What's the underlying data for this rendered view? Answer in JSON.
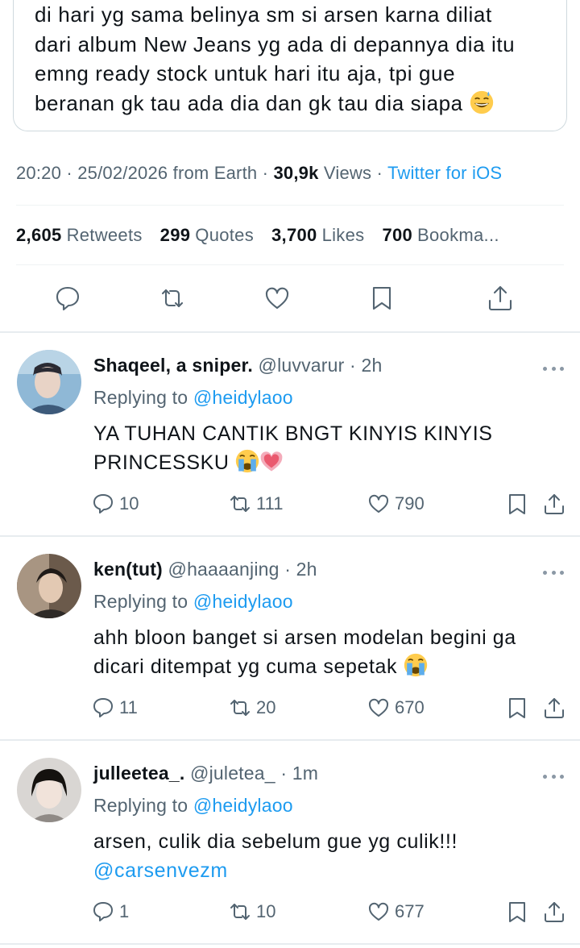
{
  "tweet": {
    "text": "di hari yg sama belinya sm si arsen karna diliat\ndari album New Jeans yg ada di depannya dia itu\nemng ready stock untuk hari itu aja, tpi gue\nberanan gk tau ada dia dan gk tau dia siapa",
    "text_emoji": "sweat-smile-emoji",
    "time": "20:20",
    "dot1": "·",
    "date": "25/02/2026 from Earth",
    "dot2": "·",
    "views_count": "30,9k",
    "views_label": "Views",
    "dot3": "·",
    "source": "Twitter for iOS"
  },
  "stats": {
    "retweets_count": "2,605",
    "retweets_label": "Retweets",
    "quotes_count": "299",
    "quotes_label": "Quotes",
    "likes_count": "3,700",
    "likes_label": "Likes",
    "bookmarks_count": "700",
    "bookmarks_label": "Bookma..."
  },
  "main_actions": [
    "reply-icon",
    "retweet-icon",
    "like-icon",
    "bookmark-icon",
    "share-icon"
  ],
  "replies": [
    {
      "name": "Shaqeel, a sniper.",
      "handle": "@luvvarur · 2h",
      "replying_label": "Replying to",
      "replying_to": "@heidylaoo",
      "text": "YA TUHAN CANTIK BNGT KINYIS KINYIS\nPRINCESSKU",
      "emojis": [
        "loudly-crying-emoji",
        "growing-heart-emoji"
      ],
      "reply_count": "10",
      "retweet_count": "111",
      "like_count": "790"
    },
    {
      "name": "ken(tut)",
      "handle": "@haaaanjing · 2h",
      "replying_label": "Replying to",
      "replying_to": "@heidylaoo",
      "text": "ahh bloon banget si arsen modelan begini ga\ndicari ditempat yg cuma sepetak",
      "emojis": [
        "loudly-crying-emoji"
      ],
      "reply_count": "11",
      "retweet_count": "20",
      "like_count": "670"
    },
    {
      "name": "julleetea_.",
      "handle": "@juletea_ · 1m",
      "replying_label": "Replying to",
      "replying_to": "@heidylaoo",
      "text": "arsen, culik dia sebelum gue yg culik!!!",
      "mention": "@carsenvezm",
      "reply_count": "1",
      "retweet_count": "10",
      "like_count": "677"
    }
  ],
  "colors": {
    "link": "#1d9bf0",
    "secondary": "#536471",
    "primary": "#0f1419",
    "border": "#cfd9de"
  }
}
